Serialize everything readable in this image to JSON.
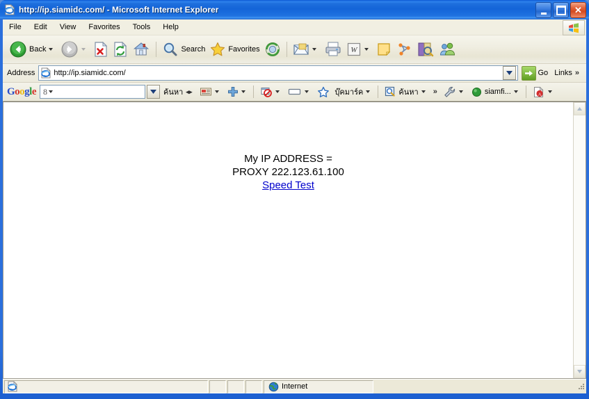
{
  "window": {
    "title": "http://ip.siamidc.com/ - Microsoft Internet Explorer",
    "icon": "ie-document-icon",
    "controls": {
      "minimize": "–",
      "maximize": "□",
      "close": "✕"
    },
    "accent_blue": "#1464d8",
    "close_red": "#d44a20"
  },
  "menu": {
    "items": [
      {
        "label": "File"
      },
      {
        "label": "Edit"
      },
      {
        "label": "View"
      },
      {
        "label": "Favorites"
      },
      {
        "label": "Tools"
      },
      {
        "label": "Help"
      }
    ],
    "logo_icon": "windows-flag-icon"
  },
  "toolbar": {
    "back_label": "Back",
    "forward_label": "",
    "search_label": "Search",
    "favorites_label": "Favorites",
    "icons": {
      "back": "back-arrow-icon",
      "forward": "forward-arrow-icon",
      "stop": "stop-icon",
      "refresh": "refresh-icon",
      "home": "home-icon",
      "search": "search-icon",
      "favorites": "star-icon",
      "history": "history-icon",
      "mail": "mail-icon",
      "print": "print-icon",
      "edit": "edit-word-icon",
      "note": "note-icon",
      "messenger_net": "network-icon",
      "research": "research-book-icon",
      "people": "messenger-people-icon"
    }
  },
  "address": {
    "label": "Address",
    "value": "http://ip.siamidc.com/",
    "placeholder": "http://",
    "icon": "ie-document-icon",
    "go_label": "Go",
    "links_label": "Links",
    "overflow": "»"
  },
  "google_toolbar": {
    "logo": {
      "g1": "G",
      "o1": "o",
      "o2": "o",
      "g2": "g",
      "l": "l",
      "e": "e"
    },
    "search_value": "8",
    "search_placeholder": "",
    "search_label": "ค้นหา",
    "bookmarks_label": "บุ๊คมาร์ค",
    "highlight_label": "ค้นหา",
    "account_label": "siamfi...",
    "overflow": "»",
    "icons": {
      "news": "news-icon",
      "plus": "plus-icon",
      "popup_blocker": "popup-blocker-icon",
      "autofill": "autofill-icon",
      "star": "star-outline-icon",
      "highlight": "highlight-search-icon",
      "settings": "wrench-icon",
      "account": "account-status-icon",
      "pdf": "pdf-icon"
    }
  },
  "page": {
    "line1": "My IP ADDRESS =",
    "line2": "PROXY 222.123.61.100",
    "link": "Speed Test",
    "link_color": "#0000cc",
    "background": "#ffffff"
  },
  "scrollbar": {
    "up": "▲",
    "down": "▼"
  },
  "statusbar": {
    "message": "",
    "zone_label": "Internet",
    "zone_icon": "globe-icon",
    "doc_icon": "ie-document-icon"
  }
}
